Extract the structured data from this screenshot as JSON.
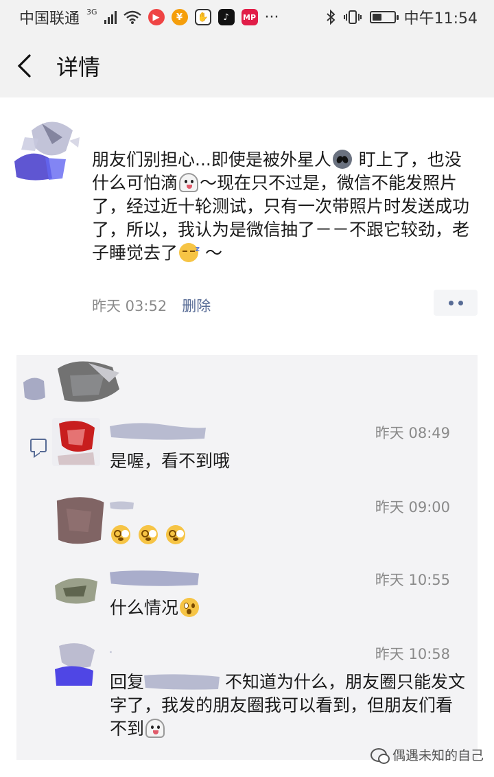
{
  "status_bar": {
    "carrier": "中国联通",
    "network": "3G",
    "time": "中午11:54"
  },
  "nav": {
    "title": "详情"
  },
  "post": {
    "text_parts": [
      "朋友们别担心...即使是被外星人",
      " 盯上了，也没什么可怕滴",
      "～现在只不过是，微信不能发照片了，经过近十轮测试，只有一次带照片时发送成功了，所以，我认为是微信抽了－－不跟它较劲，老子睡觉去了",
      " ～"
    ],
    "time": "昨天 03:52",
    "delete_label": "删除"
  },
  "comments": [
    {
      "time": "昨天 08:49",
      "text": "是喔，看不到哦"
    },
    {
      "time": "昨天 09:00",
      "text": ""
    },
    {
      "time": "昨天 10:55",
      "text": "什么情况"
    },
    {
      "time": "昨天 10:58",
      "reply_prefix": "回复",
      "text": " 不知道为什么，朋友圈只能发文字了，我发的朋友圈我可以看到，但朋友们看不到"
    }
  ],
  "watermark": {
    "text": "偶遇未知的自己"
  },
  "colors": {
    "link": "#576b95",
    "panel": "#f3f3f5",
    "bar": "#f2f2f2"
  },
  "icons": [
    "back-arrow-icon",
    "comment-icon",
    "more-dots-icon",
    "alien-emoji",
    "ghost-emoji",
    "sleepy-emoji",
    "dizzy-emoji",
    "shocked-emoji",
    "wechat-icon"
  ]
}
